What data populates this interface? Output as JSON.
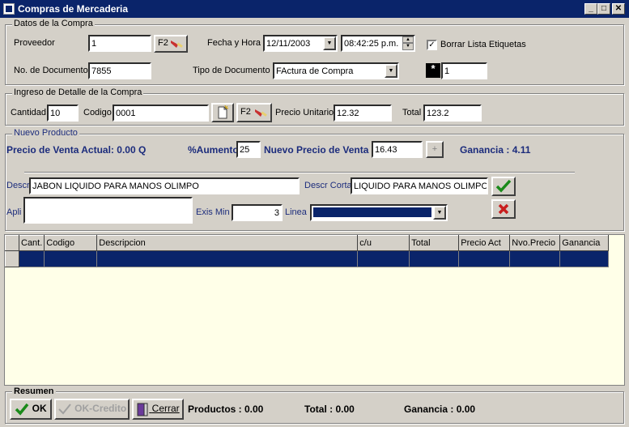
{
  "window": {
    "title": "Compras de Mercaderia"
  },
  "datos_compra": {
    "legend": "Datos de la Compra",
    "proveedor_label": "Proveedor",
    "proveedor_value": "1",
    "f2_label": "F2",
    "fecha_label": "Fecha y Hora",
    "fecha_value": "12/11/2003",
    "hora_value": "08:42:25 p.m.",
    "borrar_label": "Borrar Lista Etiquetas",
    "documento_label": "No. de Documento",
    "documento_value": "7855",
    "tipo_label": "Tipo de Documento",
    "tipo_value": "FActura de Compra",
    "asterisk": "*",
    "copias_value": "1"
  },
  "detalle": {
    "legend": "Ingreso de Detalle de la Compra",
    "cantidad_label": "Cantidad",
    "cantidad_value": "10",
    "codigo_label": "Codigo",
    "codigo_value": "0001",
    "f2_label": "F2",
    "precio_label": "Precio Unitario",
    "precio_value": "12.32",
    "total_label": "Total",
    "total_value": "123.2"
  },
  "nuevo_producto": {
    "legend": "Nuevo Producto",
    "precio_actual": "Precio de Venta Actual: 0.00 Q",
    "aumento_label": "%Aumento",
    "aumento_value": "25",
    "nuevo_precio_label": "Nuevo Precio de Venta",
    "nuevo_precio_value": "16.43",
    "plus": "+",
    "ganancia": "Ganancia : 4.11",
    "descr_label": "Descr",
    "descr_value": "JABON LIQUIDO PARA MANOS OLIMPO",
    "descr_corta_label": "Descr Corta",
    "descr_corta_value": "LIQUIDO PARA MANOS OLIMPO",
    "apli_label": "Apli",
    "apli_value": "",
    "exis_label": "Exis Min",
    "exis_value": "3",
    "linea_label": "Linea",
    "linea_value": ""
  },
  "grid": {
    "columns": [
      "Cant.",
      "Codigo",
      "Descripcion",
      "c/u",
      "Total",
      "Precio Act",
      "Nvo.Precio",
      "Ganancia"
    ]
  },
  "resumen": {
    "legend": "Resumen",
    "ok_label": "OK",
    "ok_credito_label": "OK-Credito",
    "cerrar_label": "Cerrar",
    "productos": "Productos : 0.00",
    "total": "Total : 0.00",
    "ganancia": "Ganancia : 0.00"
  },
  "colors": {
    "titlebar": "#0a246a",
    "selection": "#0a246a",
    "grid_bg": "#ffffe8",
    "accent_green": "#1a8a1a",
    "accent_red": "#c81e1e"
  }
}
